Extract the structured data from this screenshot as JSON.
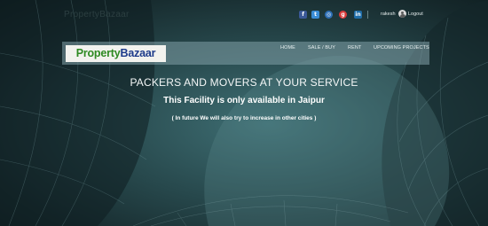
{
  "header": {
    "faded_logo": "PropertyBazaar",
    "social": [
      {
        "icon": "facebook-icon",
        "glyph": "f"
      },
      {
        "icon": "twitter-icon",
        "glyph": "t"
      },
      {
        "icon": "instagram-icon",
        "glyph": "◎"
      },
      {
        "icon": "google-plus-icon",
        "glyph": "g"
      },
      {
        "icon": "linkedin-icon",
        "glyph": "in"
      }
    ],
    "username": "rakesh",
    "logout_label": "Logout"
  },
  "nav": {
    "brand_part1": "Property",
    "brand_part2": "Bazaar",
    "items": [
      "HOME",
      "SALE / BUY",
      "RENT",
      "UPCOMING PROJECTS"
    ]
  },
  "hero": {
    "heading": "PACKERS AND MOVERS AT YOUR SERVICE",
    "subheading": "This Facility is only available in Jaipur",
    "note": "( In future We will also try to increase in other cities )"
  },
  "colors": {
    "brand_green": "#2e8a22",
    "brand_blue": "#1d3a8a",
    "background_teal": "#27484c"
  }
}
